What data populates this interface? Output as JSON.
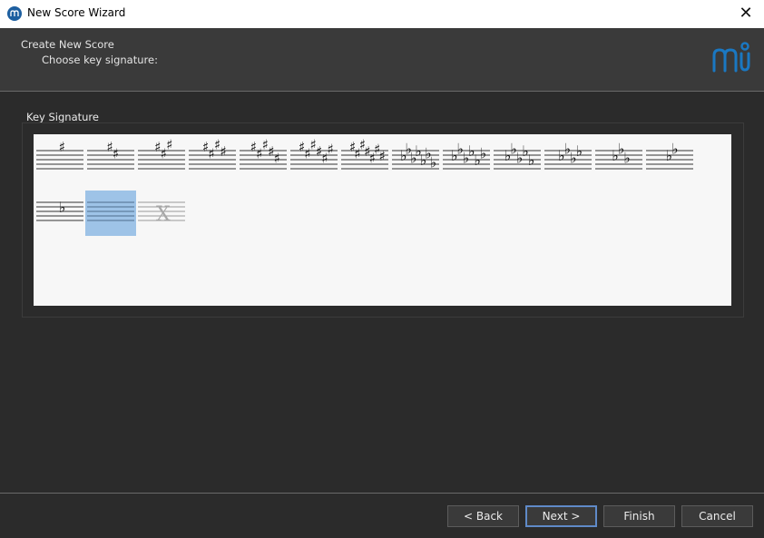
{
  "window": {
    "title": "New Score Wizard",
    "close_glyph": "✕"
  },
  "header": {
    "title": "Create New Score",
    "subtitle": "Choose key signature:",
    "logo_icon": "musescore-logo-icon"
  },
  "group": {
    "label": "Key Signature"
  },
  "key_signatures": [
    {
      "accidental": "sharp",
      "count": 1
    },
    {
      "accidental": "sharp",
      "count": 2
    },
    {
      "accidental": "sharp",
      "count": 3
    },
    {
      "accidental": "sharp",
      "count": 4
    },
    {
      "accidental": "sharp",
      "count": 5
    },
    {
      "accidental": "sharp",
      "count": 6
    },
    {
      "accidental": "sharp",
      "count": 7
    },
    {
      "accidental": "flat",
      "count": 7
    },
    {
      "accidental": "flat",
      "count": 6
    },
    {
      "accidental": "flat",
      "count": 5
    },
    {
      "accidental": "flat",
      "count": 4
    },
    {
      "accidental": "flat",
      "count": 3
    },
    {
      "accidental": "flat",
      "count": 2
    },
    {
      "accidental": "flat",
      "count": 1
    },
    {
      "accidental": "none",
      "count": 0,
      "selected": true
    },
    {
      "accidental": "open",
      "count": 0
    }
  ],
  "buttons": {
    "back": "< Back",
    "next": "Next >",
    "finish": "Finish",
    "cancel": "Cancel"
  },
  "colors": {
    "selected": "#9ec3e7",
    "accent": "#1d5fa0",
    "palette_bg": "#f7f7f7"
  }
}
